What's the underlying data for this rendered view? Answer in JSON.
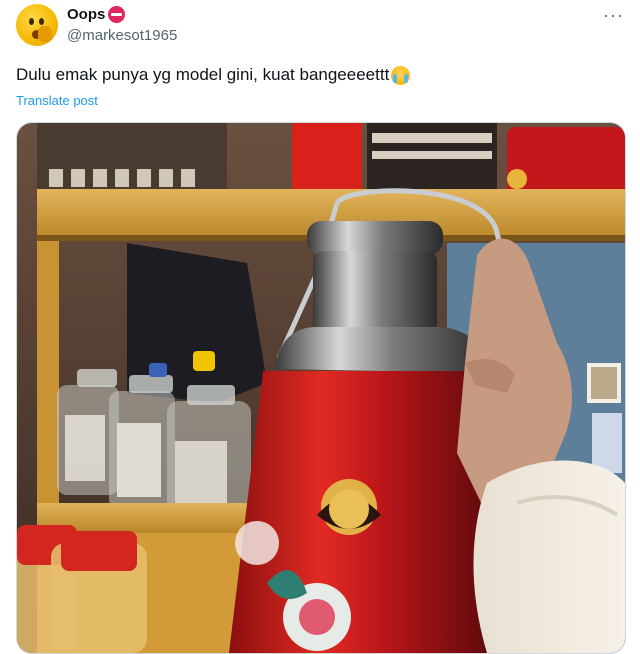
{
  "author": {
    "display_name": "Oops",
    "name_badge_icon": "no-entry-icon",
    "handle": "@markesot1965",
    "avatar_icon": "emoji-shushing-face-avatar"
  },
  "post": {
    "text": "Dulu emak punya yg model gini, kuat bangeeeettt",
    "trailing_emoji_icon": "loudly-crying-face-icon",
    "translate_label": "Translate post"
  },
  "menu": {
    "icon": "more-horizontal-icon",
    "label": "···"
  },
  "media": {
    "subject": "photo-of-red-floral-vacuum-flask-held-in-hand"
  },
  "colors": {
    "link": "#1d9bf0",
    "secondary_text": "#536471",
    "badge": "#e0245e"
  }
}
